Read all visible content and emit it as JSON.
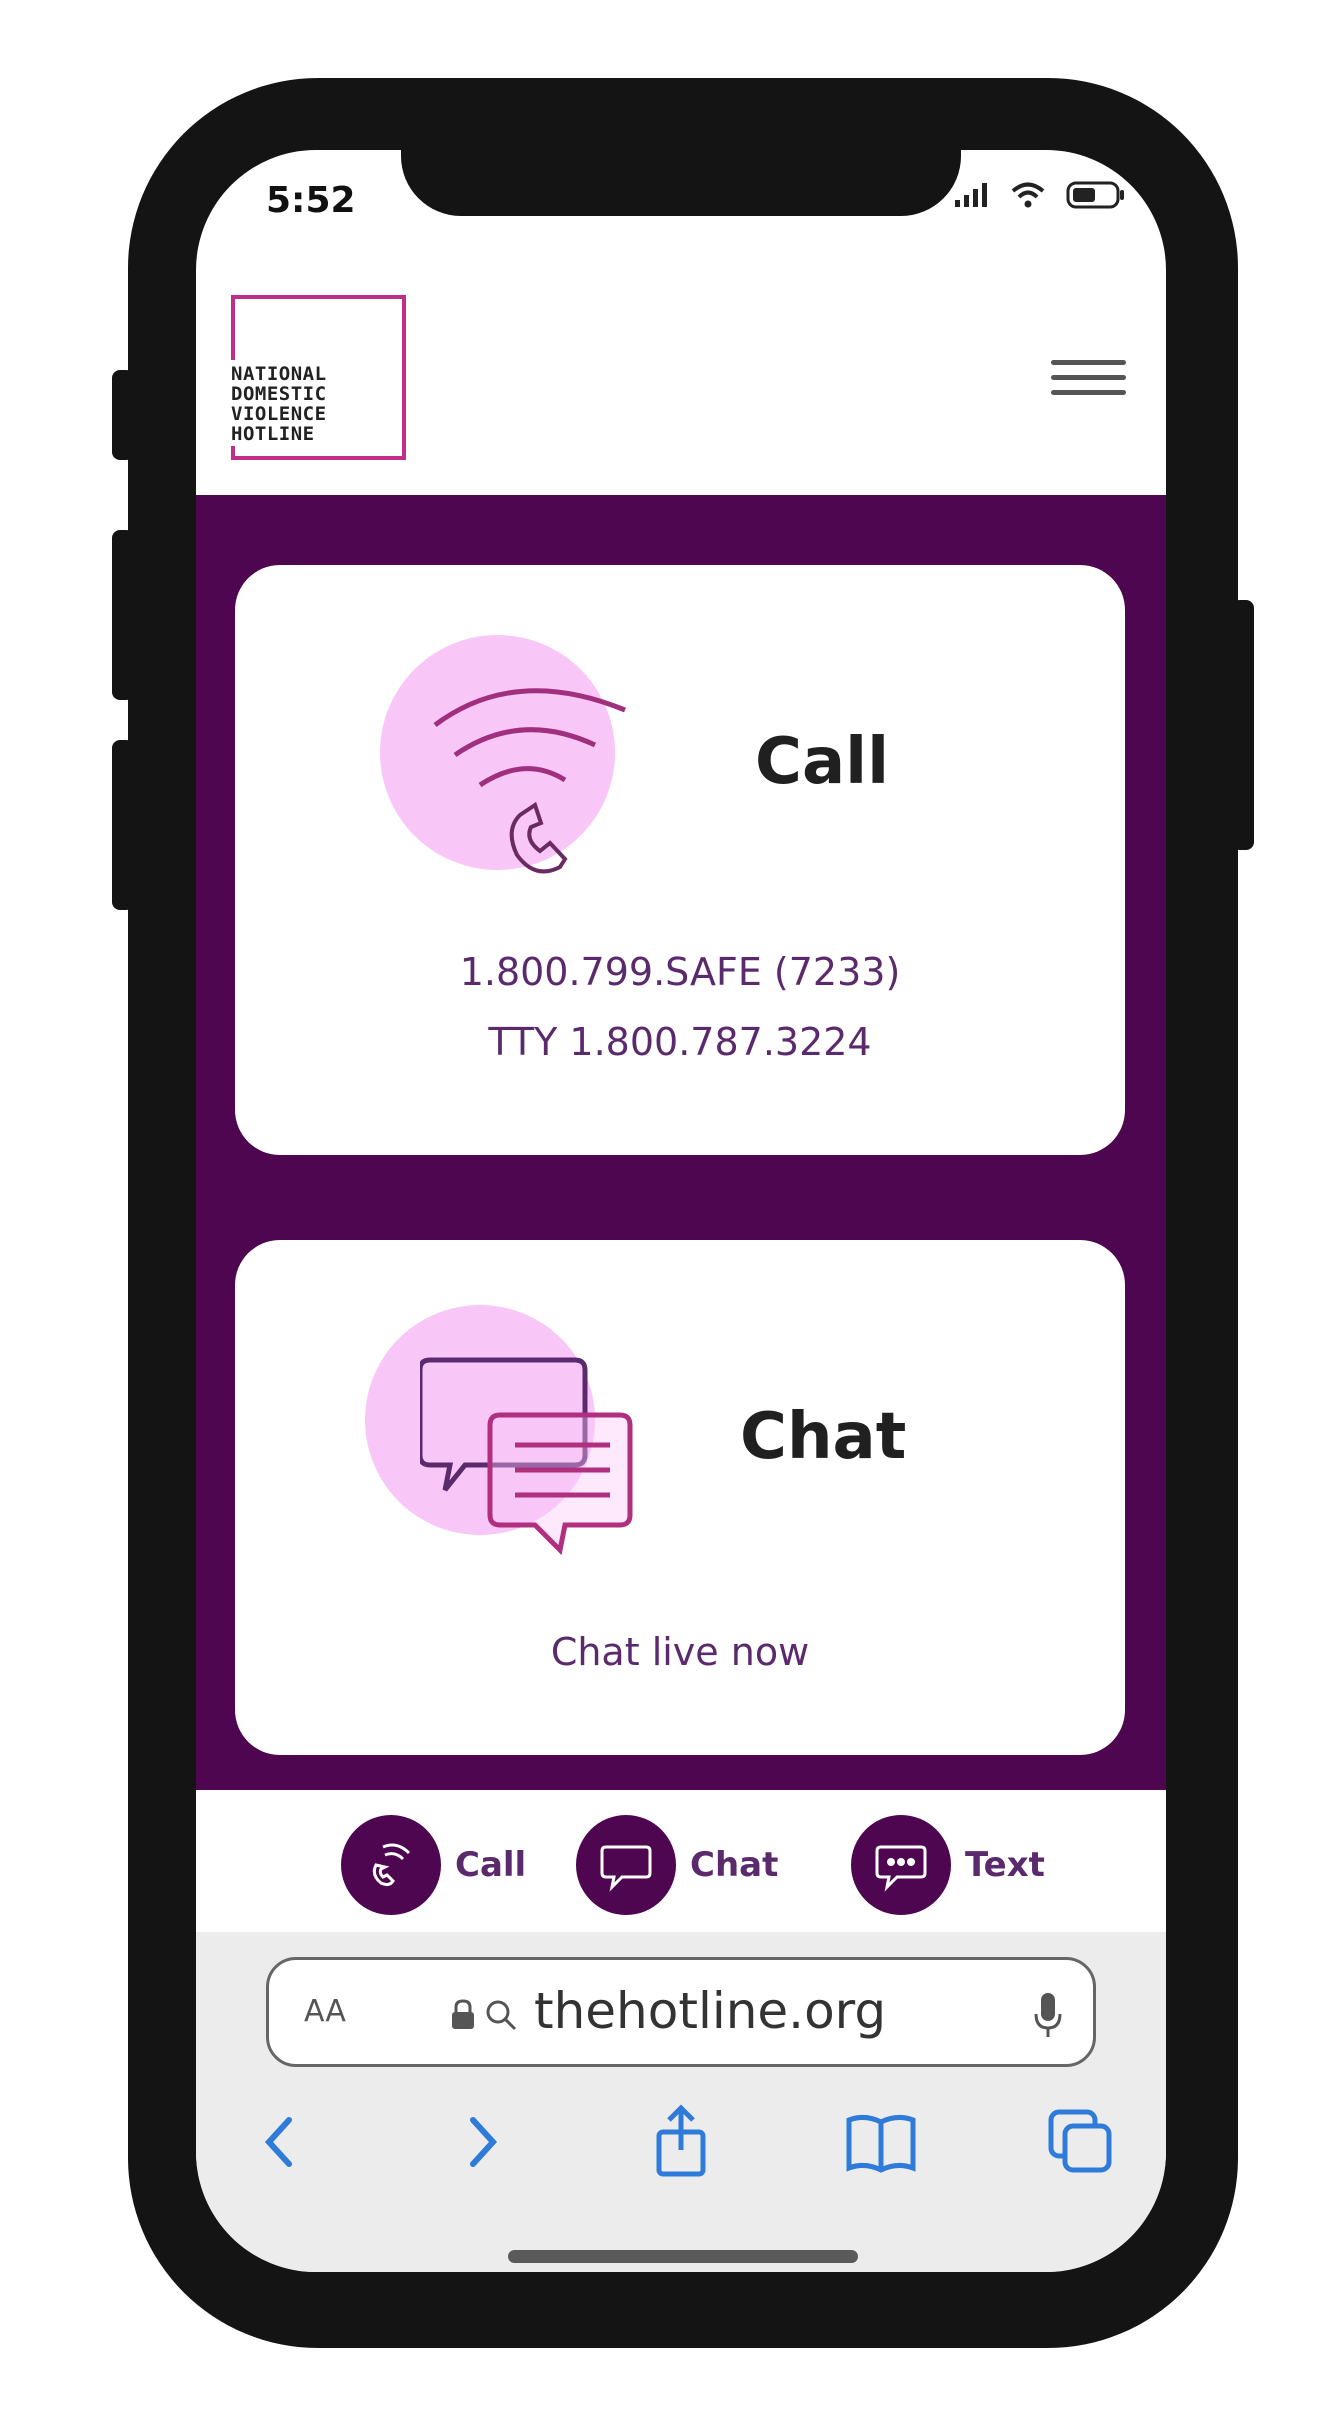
{
  "status_bar": {
    "time": "5:52"
  },
  "logo": {
    "text": "NATIONAL\nDOMESTIC\nVIOLENCE\nHOTLINE"
  },
  "call_card": {
    "title": "Call",
    "phone": "1.800.799.SAFE (7233)",
    "tty": "TTY 1.800.787.3224"
  },
  "chat_card": {
    "title": "Chat",
    "link": "Chat live now"
  },
  "bottom_bar": {
    "call_label": "Call",
    "chat_label": "Chat",
    "text_label": "Text"
  },
  "browser": {
    "aa_label": "AA",
    "url": "thehotline.org"
  },
  "colors": {
    "brand_purple": "#4d064f",
    "accent_pink": "#f9c6f8",
    "logo_magenta": "#c02e8a",
    "ios_blue": "#2f7bd9"
  }
}
